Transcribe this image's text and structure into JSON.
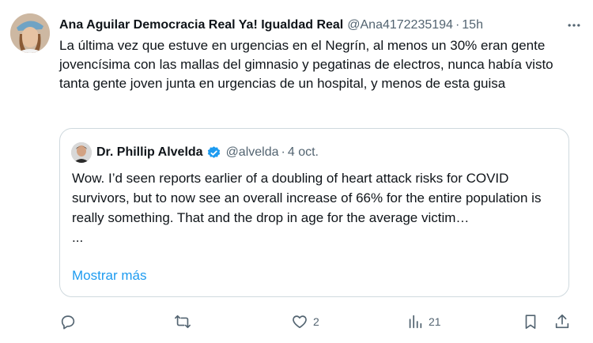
{
  "tweet": {
    "author_name": "Ana Aguilar Democracia Real Ya! Igualdad Real",
    "author_handle": "@Ana4172235194",
    "separator": "·",
    "timestamp": "15h",
    "text": "La última vez que estuve en urgencias en el Negrín, al menos un 30% eran gente jovencísima con las mallas del gimnasio y pegatinas de electros, nunca había visto tanta gente joven junta en urgencias de un hospital, y menos de esta guisa",
    "more_icon": "more-dots-icon"
  },
  "quoted": {
    "author_name": "Dr. Phillip Alvelda",
    "author_handle": "@alvelda",
    "separator": "·",
    "date": "4 oct.",
    "verified_icon": "verified-badge-icon",
    "text": "Wow. I’d seen reports earlier of a doubling of heart attack risks for COVID survivors, but to now see an overall increase of 66% for the entire population is really something. That and the drop in age for the average victim…",
    "ellipsis": "...",
    "show_more": "Mostrar más"
  },
  "actions": {
    "reply_icon": "reply-icon",
    "retweet_icon": "retweet-icon",
    "like_icon": "like-icon",
    "like_count": "2",
    "views_icon": "views-icon",
    "views_count": "21",
    "bookmark_icon": "bookmark-icon",
    "share_icon": "share-icon"
  },
  "colors": {
    "text": "#0f1419",
    "secondary": "#536471",
    "link": "#1d9bf0",
    "border": "#cfd9de"
  }
}
